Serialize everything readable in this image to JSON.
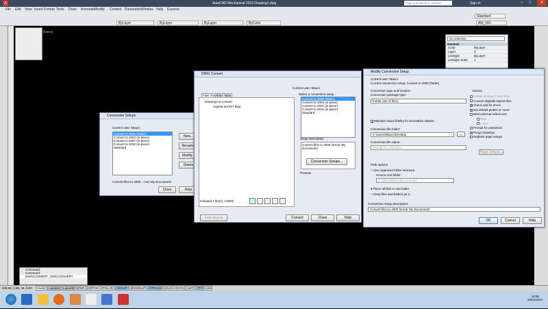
{
  "app": {
    "title": "AutoCAD Mechanical 2013   Drawing1.dwg",
    "search_placeholder": "Type a keyword or phrase",
    "sign_in": "Sign In"
  },
  "menu": [
    "File",
    "Edit",
    "View",
    "Insert",
    "Format",
    "Tools",
    "Draw",
    "Annotate",
    "Modify",
    "Content",
    "Parametric",
    "Window",
    "Help",
    "Express"
  ],
  "toolbars": {
    "layer": "ByLayer",
    "linetype": "ByLayer",
    "lineweight": "ByLayer",
    "color": "ByColor",
    "style": "Standard",
    "dimstyle": "AM_ISO"
  },
  "viewport_label": "[frame]",
  "properties": {
    "selection": "No selection",
    "section": "General",
    "rows": [
      {
        "k": "Color",
        "v": "ByLayer"
      },
      {
        "k": "Layer",
        "v": "0"
      },
      {
        "k": "Linetype",
        "v": "ByLayer"
      },
      {
        "k": "Linetype scale",
        "v": "1"
      }
    ]
  },
  "conv_setups": {
    "title": "Conversion Setups",
    "current_user": "Current user:  Mauro",
    "items": [
      "Convert to 2000 (folder)",
      "Convert to 2004 (in-place)",
      "Convert to 2007 (in-place)",
      "Convert to 2010 (in-place)",
      "Standard"
    ],
    "buttons": {
      "new": "New...",
      "rename": "Rename",
      "modify": "Modify...",
      "delete": "Delete"
    },
    "description": "Convert files to 2000 ...mat 'My Documents'",
    "close": "Close",
    "help": "Help"
  },
  "dwg_convert": {
    "title": "DWG Convert",
    "current_user": "Current user: Mauro",
    "tabs": [
      "Files Tree",
      "Files Table"
    ],
    "tree_root": "Drawings to convert",
    "tree_file": "original ac1027.dwg",
    "select_label": "Select a conversion setup",
    "setups": [
      "Convert to 2000 (folder)",
      "Convert to 2004 (in-place)",
      "Convert to 2007 (in-place)",
      "Convert to 2010 (in-place)",
      "Standard"
    ],
    "setup_desc_label": "Setup description",
    "setup_desc": "Convert files to 2000 format 'My Documents'",
    "conv_setups_btn": "Conversion Setups...",
    "preview_label": "Preview",
    "included": "Included 1 file(s), 149KB",
    "view_report": "View Report",
    "convert": "Convert",
    "close": "Close",
    "help": "Help"
  },
  "modify_setup": {
    "title": "Modify Conversion Setup",
    "current_user": "Current user: Mauro",
    "current_setup": "Current conversion setup: Convert to 2000 (folder)",
    "type_location": "Conversion type and location",
    "package_type_label": "Conversion package type:",
    "package_type": "Folder (set of files)",
    "maintain_fidelity": "Maintain visual fidelity for annotative objects",
    "file_folder_label": "Conversion file folder:",
    "file_folder": "C:\\Users\\Mauro\\Desktop",
    "file_name_label": "Conversion file name:",
    "file_name_placeholder": "Prompt for a filename",
    "path_options": "Path options",
    "use_organized": "Use organized folder structure",
    "source_root": "Source root folder:",
    "source_root_value": "C:\\Users\\Mauro\\Documents\\",
    "place_all": "Place all files in one folder",
    "keep_files": "Keep files and folders as is",
    "desc_label": "Conversion setup description:",
    "desc_value": "Convert files to 2000 format 'My Documents'",
    "actions": "Actions",
    "action_items": [
      {
        "label": "Create backup (*.bak) files",
        "enabled": false,
        "checked": false
      },
      {
        "label": "Convert digitally signed files",
        "enabled": true,
        "checked": false
      },
      {
        "label": "Check and fix errors",
        "enabled": true,
        "checked": true
      },
      {
        "label": "Set default plotter to 'none'",
        "enabled": true,
        "checked": true
      },
      {
        "label": "Bind external references",
        "enabled": true,
        "checked": false
      },
      {
        "label": "Bind",
        "enabled": false,
        "checked": false
      },
      {
        "label": "Insert",
        "enabled": false,
        "checked": false
      },
      {
        "label": "Prompt for password",
        "enabled": true,
        "checked": false
      },
      {
        "label": "Purge drawings",
        "enabled": true,
        "checked": true
      },
      {
        "label": "Replace page setups",
        "enabled": true,
        "checked": false
      }
    ],
    "page_setups": "Page Setups...",
    "ok": "OK",
    "cancel": "Cancel",
    "help": "Help"
  },
  "command": {
    "line1": "Command:",
    "line2": "Command:",
    "line3": "DWGCONVERT _DWGCONVERT"
  },
  "status": {
    "coords": "536.59, 2.95, 44, 0.00",
    "toggles": [
      "INFER",
      "ORTHO",
      "POLAR",
      "OSNAP",
      "3DOSNAP",
      "OTRACK",
      "DUCS",
      "DYN",
      "LWT",
      "TPY",
      "AM"
    ],
    "tabs": [
      "Model",
      "Layout1",
      "Layout2"
    ]
  },
  "clock": {
    "time": "18:56",
    "date": "29/01/2017"
  }
}
